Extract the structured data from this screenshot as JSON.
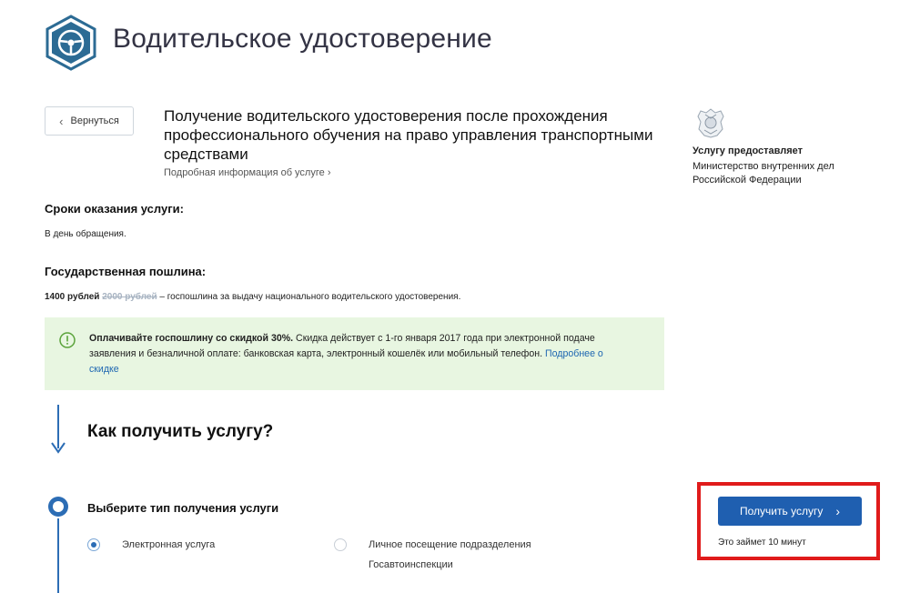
{
  "header": {
    "title": "Водительское удостоверение",
    "logo_icon": "steering-wheel-icon",
    "accent": "#2c6b94"
  },
  "nav": {
    "back_label": "Вернуться"
  },
  "service": {
    "title": "Получение водительского удостоверения после прохождения профессионального обучения на право управления транспортными средствами",
    "more_link": "Подробная информация об услуге"
  },
  "provider": {
    "label": "Услугу предоставляет",
    "name": "Министерство внутренних дел Российской Федерации",
    "emblem_icon": "coat-of-arms-icon"
  },
  "terms": {
    "heading": "Сроки оказания услуги:",
    "text": "В день обращения."
  },
  "fee": {
    "heading": "Государственная пошлина:",
    "current": "1400 рублей",
    "old": "2000 рублей",
    "description": "– госпошлина за выдачу национального водительского удостоверения."
  },
  "notice": {
    "bold": "Оплачивайте госпошлину со скидкой 30%.",
    "text": " Скидка действует с 1-го января 2017 года при электронной подаче заявления и безналичной оплате: банковская карта, электронный кошелёк или мобильный телефон. ",
    "link": "Подробнее о скидке",
    "background": "#e8f6e1"
  },
  "steps": {
    "heading": "Как получить услугу?",
    "step1_title": "Выберите тип получения услуги",
    "options": [
      {
        "label": "Электронная услуга",
        "selected": true
      },
      {
        "label": "Личное посещение подразделения Госавтоинспекции",
        "selected": false
      }
    ]
  },
  "cta": {
    "button_label": "Получить услугу",
    "note": "Это займет 10 минут",
    "button_color": "#1f5fb0",
    "highlight_color": "#e01b1b"
  }
}
